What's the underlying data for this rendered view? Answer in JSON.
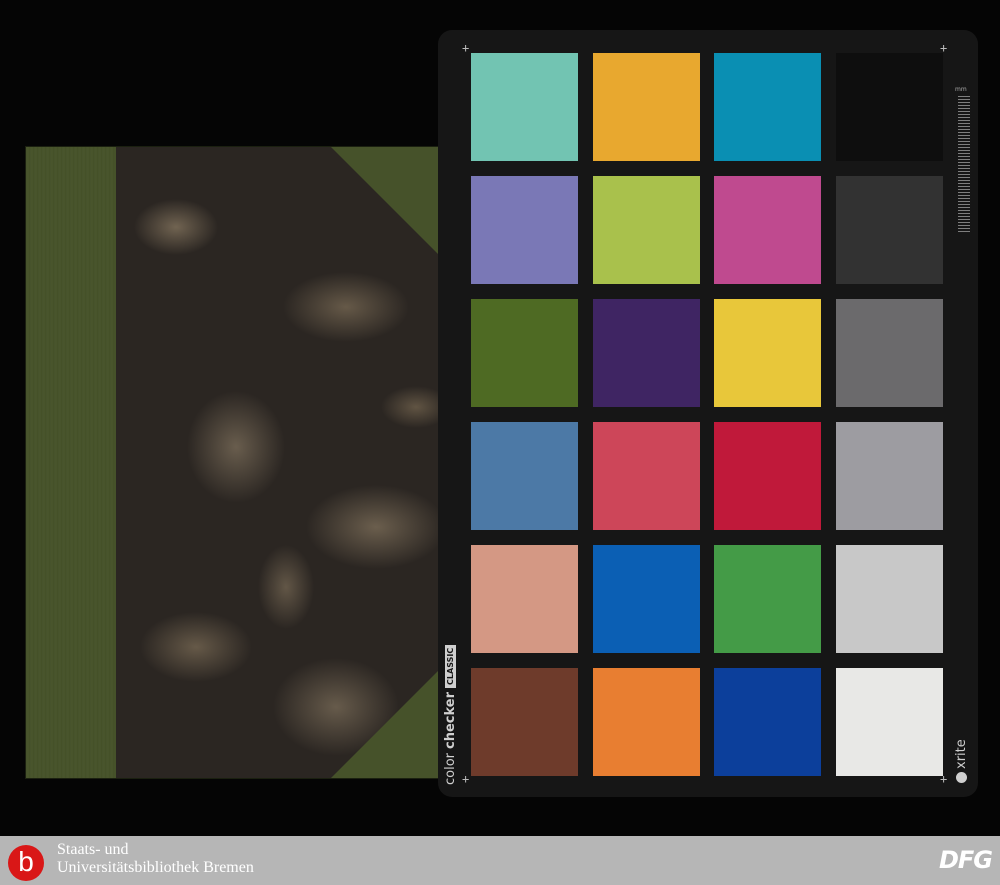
{
  "colorchecker": {
    "brand_light": "color",
    "brand_bold": "checker",
    "edition": "CLASSIC",
    "maker": "xrite",
    "ruler_unit": "mm",
    "patch_colors": [
      [
        "#72c4b2",
        "#e8a82f",
        "#0a8fb3",
        "#0e0e0e"
      ],
      [
        "#7a78b6",
        "#a9c14c",
        "#bf4a8f",
        "#323232"
      ],
      [
        "#4e6a23",
        "#3f2563",
        "#e8c73a",
        "#6b6a6c"
      ],
      [
        "#4c79a6",
        "#cd4659",
        "#c0193a",
        "#9d9ca1"
      ],
      [
        "#d49884",
        "#0b5fb4",
        "#449b47",
        "#c8c8c8"
      ],
      [
        "#6e3b2b",
        "#e87e31",
        "#0c3f9b",
        "#e8e8e6"
      ]
    ]
  },
  "footer": {
    "logo_letter": "b",
    "library_line1": "Staats- und",
    "library_line2": "Universitätsbibliothek Bremen",
    "funder_logo": "DFG"
  },
  "colors": {
    "book_cloth": "#46522a",
    "footer_bg": "#b6b6b6",
    "logo_red": "#d91717"
  }
}
